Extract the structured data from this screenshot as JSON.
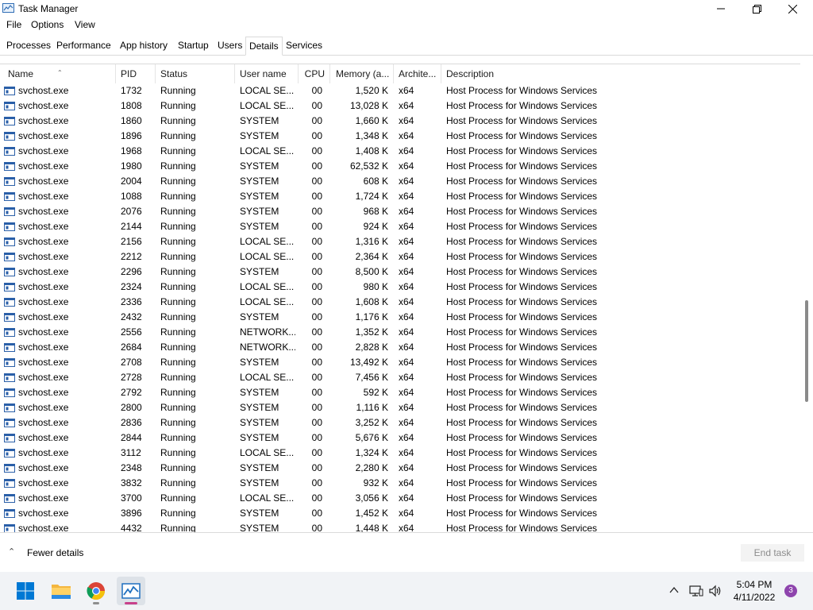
{
  "window": {
    "title": "Task Manager"
  },
  "menu": [
    "File",
    "Options",
    "View"
  ],
  "tabs": [
    "Processes",
    "Performance",
    "App history",
    "Startup",
    "Users",
    "Details",
    "Services"
  ],
  "active_tab": "Details",
  "columns": [
    "Name",
    "PID",
    "Status",
    "User name",
    "CPU",
    "Memory (a...",
    "Archite...",
    "Description"
  ],
  "sort_column": "Name",
  "rows": [
    [
      "svchost.exe",
      "1732",
      "Running",
      "LOCAL SE...",
      "00",
      "1,520 K",
      "x64",
      "Host Process for Windows Services"
    ],
    [
      "svchost.exe",
      "1808",
      "Running",
      "LOCAL SE...",
      "00",
      "13,028 K",
      "x64",
      "Host Process for Windows Services"
    ],
    [
      "svchost.exe",
      "1860",
      "Running",
      "SYSTEM",
      "00",
      "1,660 K",
      "x64",
      "Host Process for Windows Services"
    ],
    [
      "svchost.exe",
      "1896",
      "Running",
      "SYSTEM",
      "00",
      "1,348 K",
      "x64",
      "Host Process for Windows Services"
    ],
    [
      "svchost.exe",
      "1968",
      "Running",
      "LOCAL SE...",
      "00",
      "1,408 K",
      "x64",
      "Host Process for Windows Services"
    ],
    [
      "svchost.exe",
      "1980",
      "Running",
      "SYSTEM",
      "00",
      "62,532 K",
      "x64",
      "Host Process for Windows Services"
    ],
    [
      "svchost.exe",
      "2004",
      "Running",
      "SYSTEM",
      "00",
      "608 K",
      "x64",
      "Host Process for Windows Services"
    ],
    [
      "svchost.exe",
      "1088",
      "Running",
      "SYSTEM",
      "00",
      "1,724 K",
      "x64",
      "Host Process for Windows Services"
    ],
    [
      "svchost.exe",
      "2076",
      "Running",
      "SYSTEM",
      "00",
      "968 K",
      "x64",
      "Host Process for Windows Services"
    ],
    [
      "svchost.exe",
      "2144",
      "Running",
      "SYSTEM",
      "00",
      "924 K",
      "x64",
      "Host Process for Windows Services"
    ],
    [
      "svchost.exe",
      "2156",
      "Running",
      "LOCAL SE...",
      "00",
      "1,316 K",
      "x64",
      "Host Process for Windows Services"
    ],
    [
      "svchost.exe",
      "2212",
      "Running",
      "LOCAL SE...",
      "00",
      "2,364 K",
      "x64",
      "Host Process for Windows Services"
    ],
    [
      "svchost.exe",
      "2296",
      "Running",
      "SYSTEM",
      "00",
      "8,500 K",
      "x64",
      "Host Process for Windows Services"
    ],
    [
      "svchost.exe",
      "2324",
      "Running",
      "LOCAL SE...",
      "00",
      "980 K",
      "x64",
      "Host Process for Windows Services"
    ],
    [
      "svchost.exe",
      "2336",
      "Running",
      "LOCAL SE...",
      "00",
      "1,608 K",
      "x64",
      "Host Process for Windows Services"
    ],
    [
      "svchost.exe",
      "2432",
      "Running",
      "SYSTEM",
      "00",
      "1,176 K",
      "x64",
      "Host Process for Windows Services"
    ],
    [
      "svchost.exe",
      "2556",
      "Running",
      "NETWORK...",
      "00",
      "1,352 K",
      "x64",
      "Host Process for Windows Services"
    ],
    [
      "svchost.exe",
      "2684",
      "Running",
      "NETWORK...",
      "00",
      "2,828 K",
      "x64",
      "Host Process for Windows Services"
    ],
    [
      "svchost.exe",
      "2708",
      "Running",
      "SYSTEM",
      "00",
      "13,492 K",
      "x64",
      "Host Process for Windows Services"
    ],
    [
      "svchost.exe",
      "2728",
      "Running",
      "LOCAL SE...",
      "00",
      "7,456 K",
      "x64",
      "Host Process for Windows Services"
    ],
    [
      "svchost.exe",
      "2792",
      "Running",
      "SYSTEM",
      "00",
      "592 K",
      "x64",
      "Host Process for Windows Services"
    ],
    [
      "svchost.exe",
      "2800",
      "Running",
      "SYSTEM",
      "00",
      "1,116 K",
      "x64",
      "Host Process for Windows Services"
    ],
    [
      "svchost.exe",
      "2836",
      "Running",
      "SYSTEM",
      "00",
      "3,252 K",
      "x64",
      "Host Process for Windows Services"
    ],
    [
      "svchost.exe",
      "2844",
      "Running",
      "SYSTEM",
      "00",
      "5,676 K",
      "x64",
      "Host Process for Windows Services"
    ],
    [
      "svchost.exe",
      "3112",
      "Running",
      "LOCAL SE...",
      "00",
      "1,324 K",
      "x64",
      "Host Process for Windows Services"
    ],
    [
      "svchost.exe",
      "2348",
      "Running",
      "SYSTEM",
      "00",
      "2,280 K",
      "x64",
      "Host Process for Windows Services"
    ],
    [
      "svchost.exe",
      "3832",
      "Running",
      "SYSTEM",
      "00",
      "932 K",
      "x64",
      "Host Process for Windows Services"
    ],
    [
      "svchost.exe",
      "3700",
      "Running",
      "LOCAL SE...",
      "00",
      "3,056 K",
      "x64",
      "Host Process for Windows Services"
    ],
    [
      "svchost.exe",
      "3896",
      "Running",
      "SYSTEM",
      "00",
      "1,452 K",
      "x64",
      "Host Process for Windows Services"
    ],
    [
      "svchost.exe",
      "4432",
      "Running",
      "SYSTEM",
      "00",
      "1,448 K",
      "x64",
      "Host Process for Windows Services"
    ]
  ],
  "row_icon": "process-window-icon",
  "footer": {
    "fewer_details": "Fewer details",
    "end_task": "End task"
  },
  "taskbar": {
    "apps": [
      "windows-start-icon",
      "file-explorer-icon",
      "chrome-icon",
      "task-manager-icon"
    ],
    "tray_icons": [
      "chevron-up-icon",
      "network-icon",
      "volume-icon"
    ],
    "time": "5:04 PM",
    "date": "4/11/2022",
    "notification_count": "3"
  },
  "colors": {
    "accent": "#0067c0",
    "text": "#000000",
    "disabled_text": "#8c8c8c",
    "taskbar": "#f1f3f6"
  }
}
